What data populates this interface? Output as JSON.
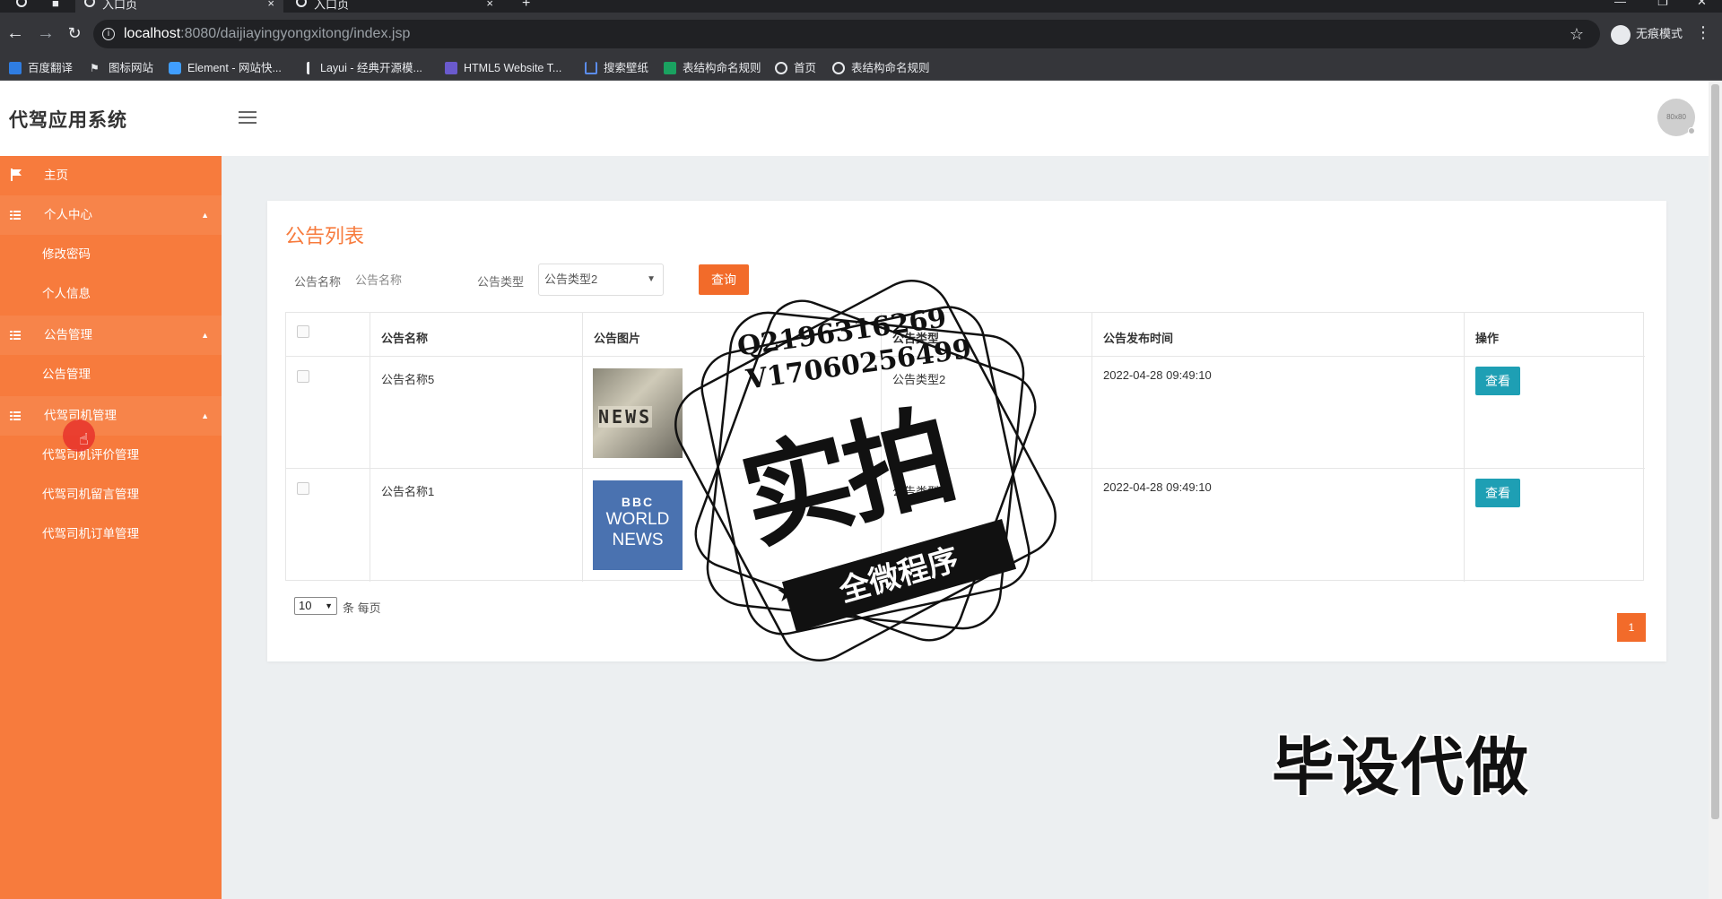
{
  "browser": {
    "tabs": [
      {
        "title": "入口页",
        "active": true
      },
      {
        "title": "入口页",
        "active": false
      }
    ],
    "url_host": "localhost",
    "url_path": ":8080/daijiayingyongxitong/index.jsp",
    "incognito_label": "无痕模式",
    "bookmarks": [
      {
        "label": "百度翻译",
        "icon": "baidu-translate-icon",
        "color": "#2f7de1"
      },
      {
        "label": "图标网站",
        "icon": "flag-icon",
        "color": "#e8eaed"
      },
      {
        "label": "Element - 网站快...",
        "icon": "element-hexagon-icon",
        "color": "#409eff"
      },
      {
        "label": "Layui - 经典开源模...",
        "icon": "layui-icon",
        "color": "#e8eaed"
      },
      {
        "label": "HTML5 Website T...",
        "icon": "html5-template-icon",
        "color": "#6a5acd"
      },
      {
        "label": "搜索壁纸",
        "icon": "wallpaper-icon",
        "color": "#5b8def"
      },
      {
        "label": "表结构命名规则",
        "icon": "sheet-icon",
        "color": "#1aa260"
      },
      {
        "label": "首页",
        "icon": "globe-icon",
        "color": "#e8eaed"
      },
      {
        "label": "表结构命名规则",
        "icon": "globe-icon",
        "color": "#e8eaed"
      }
    ]
  },
  "app": {
    "title": "代驾应用系统",
    "avatar_text": "80x80"
  },
  "sidebar": {
    "items": [
      {
        "label": "主页",
        "type": "link",
        "icon": "flag-icon"
      },
      {
        "label": "个人中心",
        "type": "group",
        "icon": "grid-icon"
      },
      {
        "label": "修改密码",
        "type": "sub"
      },
      {
        "label": "个人信息",
        "type": "sub"
      },
      {
        "label": "公告管理",
        "type": "group",
        "icon": "grid-icon"
      },
      {
        "label": "公告管理",
        "type": "sub"
      },
      {
        "label": "代驾司机管理",
        "type": "group",
        "icon": "grid-icon"
      },
      {
        "label": "代驾司机评价管理",
        "type": "sub"
      },
      {
        "label": "代驾司机留言管理",
        "type": "sub"
      },
      {
        "label": "代驾司机订单管理",
        "type": "sub"
      }
    ]
  },
  "panel": {
    "title": "公告列表",
    "search": {
      "name_label": "公告名称",
      "name_placeholder": "公告名称",
      "type_label": "公告类型",
      "type_selected": "公告类型2",
      "query_button": "查询"
    },
    "table": {
      "headers": [
        "",
        "公告名称",
        "公告图片",
        "公告类型",
        "公告发布时间",
        "操作"
      ],
      "rows": [
        {
          "name": "公告名称5",
          "image": "NEWS",
          "type": "公告类型2",
          "time": "2022-04-28 09:49:10",
          "action": "查看"
        },
        {
          "name": "公告名称1",
          "image": "BBC WORLD NEWS",
          "type": "公告类型",
          "time": "2022-04-28 09:49:10",
          "action": "查看"
        }
      ]
    },
    "page_size": "10",
    "page_size_label": "条 每页",
    "current_page": "1"
  },
  "watermark": {
    "line1": "Q2196316269",
    "line2": "V17060256499",
    "big": "实拍",
    "banner": "全微程序",
    "corner": "毕设代做"
  },
  "colors": {
    "sidebar": "#f77b3d",
    "accent": "#f26b2a",
    "view_button": "#1e9fb4"
  }
}
